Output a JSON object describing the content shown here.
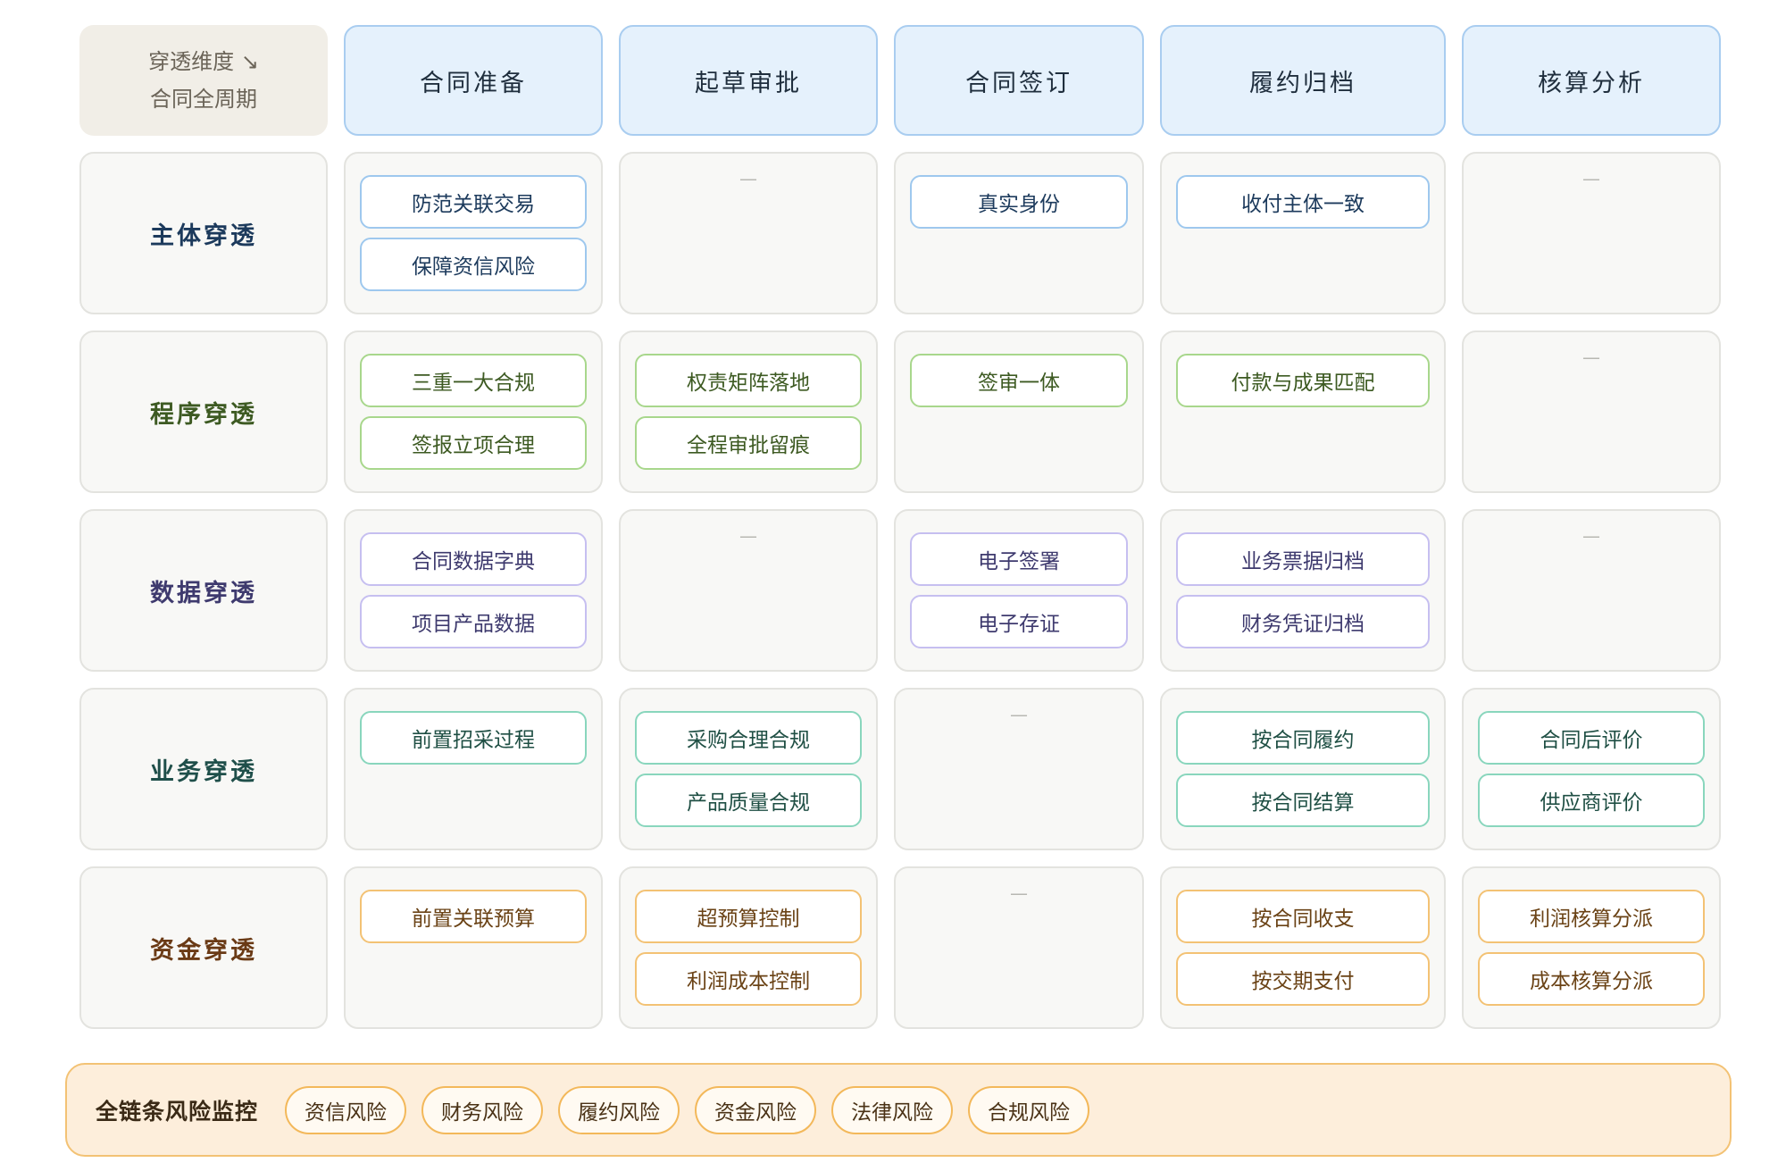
{
  "corner": {
    "line1": "穿透维度 ↘",
    "line2": "合同全周期"
  },
  "stages": [
    "合同准备",
    "起草审批",
    "合同签订",
    "履约归档",
    "核算分析"
  ],
  "rows": [
    {
      "label": "主体穿透",
      "color": "blue",
      "cells": [
        [
          "防范关联交易",
          "保障资信风险"
        ],
        [],
        [
          "真实身份"
        ],
        [
          "收付主体一致"
        ],
        []
      ]
    },
    {
      "label": "程序穿透",
      "color": "green",
      "cells": [
        [
          "三重一大合规",
          "签报立项合理"
        ],
        [
          "权责矩阵落地",
          "全程审批留痕"
        ],
        [
          "签审一体"
        ],
        [
          "付款与成果匹配"
        ],
        []
      ]
    },
    {
      "label": "数据穿透",
      "color": "purple",
      "cells": [
        [
          "合同数据字典",
          "项目产品数据"
        ],
        [],
        [
          "电子签署",
          "电子存证"
        ],
        [
          "业务票据归档",
          "财务凭证归档"
        ],
        []
      ]
    },
    {
      "label": "业务穿透",
      "color": "teal",
      "cells": [
        [
          "前置招采过程"
        ],
        [
          "采购合理合规",
          "产品质量合规"
        ],
        [],
        [
          "按合同履约",
          "按合同结算"
        ],
        [
          "合同后评价",
          "供应商评价"
        ]
      ]
    },
    {
      "label": "资金穿透",
      "color": "orange",
      "cells": [
        [
          "前置关联预算"
        ],
        [
          "超预算控制",
          "利润成本控制"
        ],
        [],
        [
          "按合同收支",
          "按交期支付"
        ],
        [
          "利润核算分派",
          "成本核算分派"
        ]
      ]
    }
  ],
  "empty_marker": "—",
  "risk": {
    "title": "全链条风险监控",
    "tags": [
      "资信风险",
      "财务风险",
      "履约风险",
      "资金风险",
      "法律风险",
      "合规风险"
    ]
  },
  "colors": {
    "blue": "#9ec8ee",
    "green": "#a8d78c",
    "purple": "#c6bff0",
    "teal": "#89d6bd",
    "orange": "#f3c274",
    "stage_bg": "#e5f1fc",
    "risk_bg": "#fdeedb"
  }
}
